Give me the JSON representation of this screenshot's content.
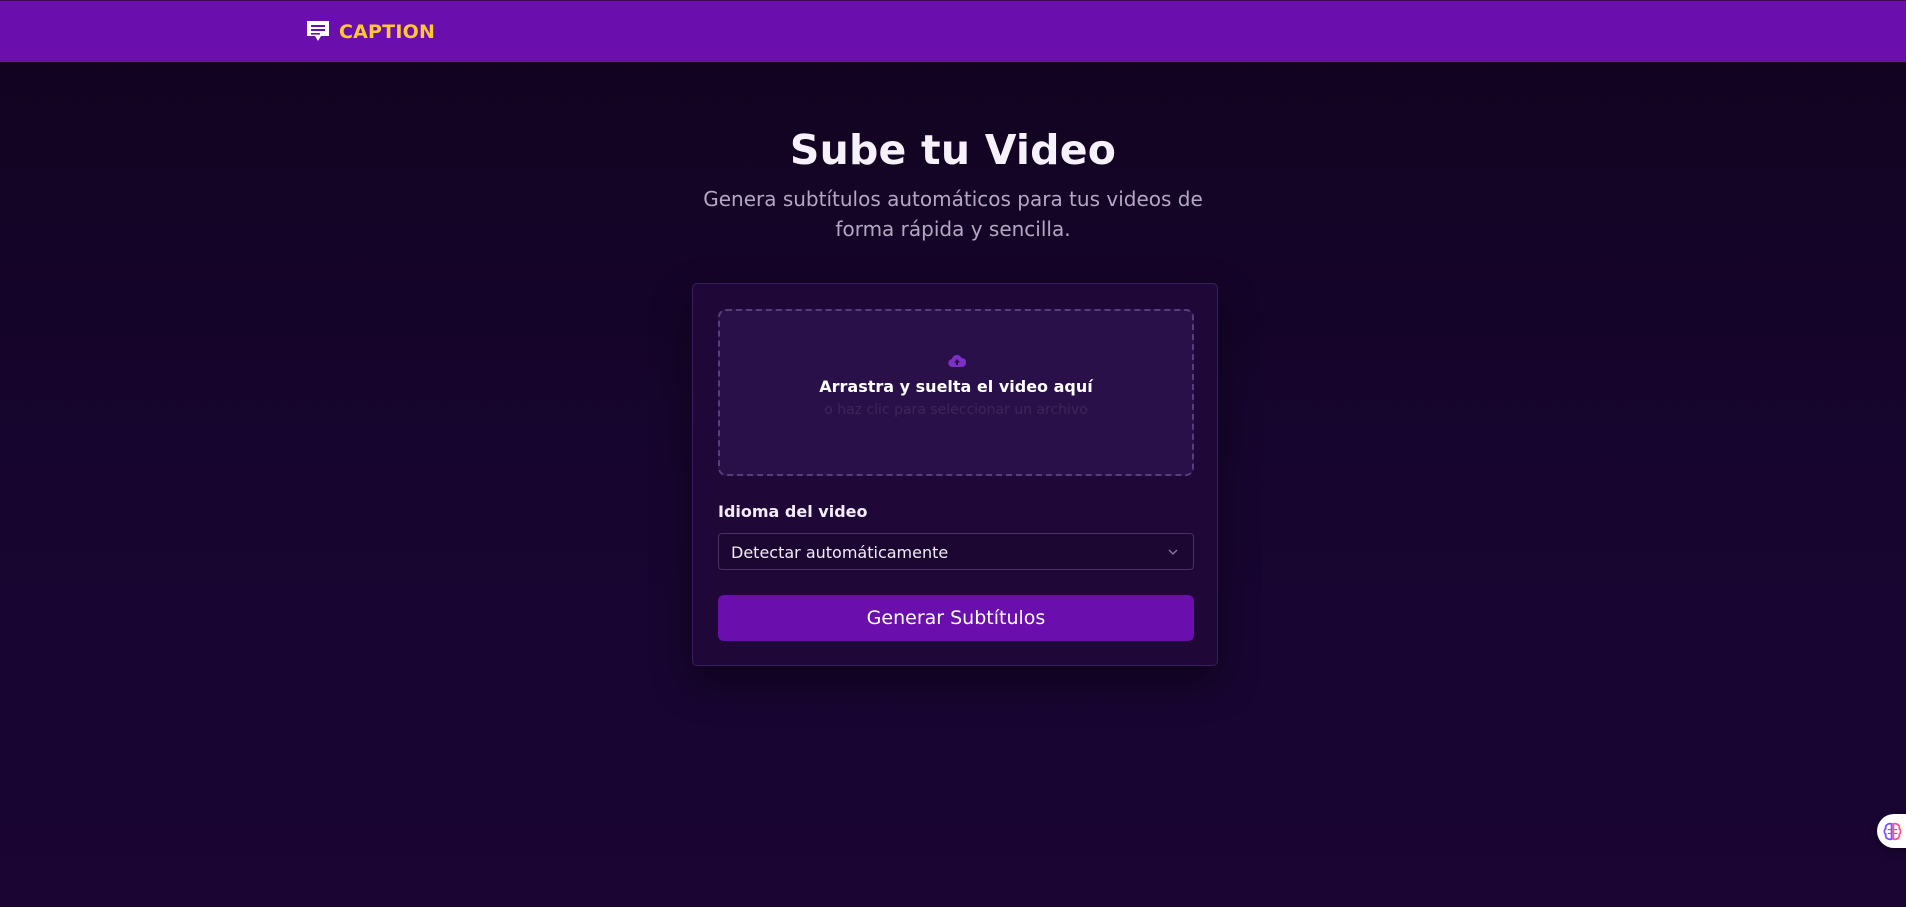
{
  "header": {
    "brand": "CAPTION",
    "logo_icon": "chat-bubble-icon",
    "brand_color": "#ffc634",
    "bar_color": "#6a0fad"
  },
  "main": {
    "title": "Sube tu Video",
    "subtitle": "Genera subtítulos automáticos para tus videos de forma rápida y sencilla."
  },
  "upload": {
    "icon": "cloud-upload-icon",
    "title": "Arrastra y suelta el video aquí",
    "hint": "o haz clic para seleccionar un archivo"
  },
  "language": {
    "label": "Idioma del video",
    "selected": "Detectar automáticamente"
  },
  "actions": {
    "generate_label": "Generar Subtítulos",
    "accent": "#6a0fad"
  },
  "widget": {
    "icon": "brain-icon"
  }
}
